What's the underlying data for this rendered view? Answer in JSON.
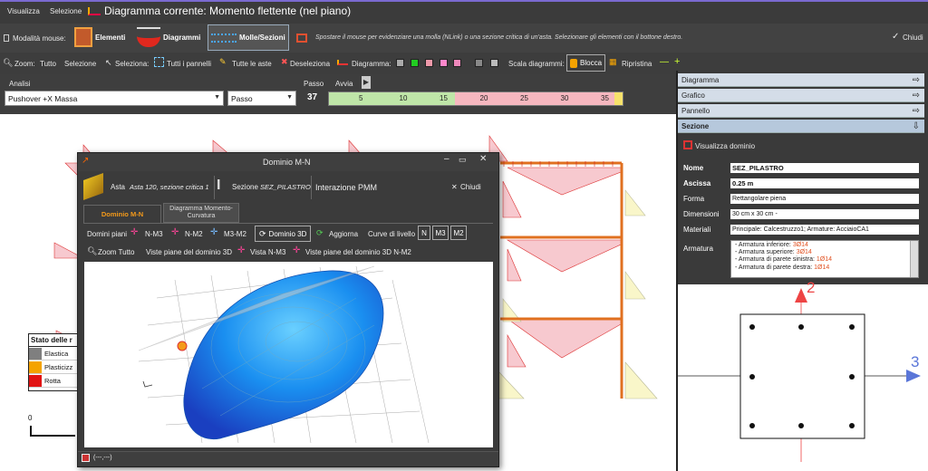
{
  "topbar": {
    "menu_visualizza": "Visualizza",
    "menu_selezione": "Selezione",
    "title": "Diagramma corrente: Momento flettente (nel piano)"
  },
  "modebar": {
    "label": "Modalità mouse:",
    "elementi": "Elementi",
    "diagrammi": "Diagrammi",
    "molle": "Molle/Sezioni",
    "hint": "Spostare il mouse per evidenziare una molla (NLink) o una sezione critica di un'asta. Selezionare gli elementi con il bottone destro.",
    "chiudi": "Chiudi"
  },
  "toolbar": {
    "zoom": "Zoom:",
    "tutto": "Tutto",
    "selezione": "Selezione",
    "seleziona": "Seleziona:",
    "tutti_pannelli": "Tutti i pannelli",
    "tutte_aste": "Tutte le aste",
    "deseleziona": "Deseleziona",
    "diagramma": "Diagramma:",
    "scala": "Scala diagrammi:",
    "blocca": "Blocca",
    "ripristina": "Ripristina"
  },
  "analysis": {
    "label": "Analisi",
    "value": "Pushover +X Massa",
    "passo_select": "Passo",
    "passo_label": "Passo",
    "avvia_label": "Avvia",
    "step": "37",
    "ticks": [
      "5",
      "10",
      "15",
      "20",
      "25",
      "30",
      "35"
    ]
  },
  "right_panel": {
    "tabs": [
      "Diagramma",
      "Grafico",
      "Pannello",
      "Sezione"
    ],
    "visualizza_dominio": "Visualizza dominio",
    "fields": [
      {
        "label": "Nome",
        "value": "SEZ_PILASTRO",
        "bold": true
      },
      {
        "label": "Ascissa",
        "value": "0.25 m",
        "bold": true
      },
      {
        "label": "Forma",
        "value": "Rettangolare piena",
        "bold": false
      },
      {
        "label": "Dimensioni",
        "value": "30 cm x 30 cm -",
        "bold": false
      },
      {
        "label": "Materiali",
        "value": "Principale: Calcestruzzo1; Armature: AcciaioCA1",
        "bold": false
      }
    ],
    "armatura_label": "Armatura",
    "armatura_lines": [
      {
        "text": "- Armatura inferiore: ",
        "value": "3Ø14"
      },
      {
        "text": "- Armatura superiore: ",
        "value": "3Ø14"
      },
      {
        "text": "- Armatura di parete sinistra: ",
        "value": "1Ø14"
      },
      {
        "text": "- Armatura di parete destra: ",
        "value": "1Ø14"
      }
    ],
    "axis_2": "2",
    "axis_3": "3"
  },
  "legend": {
    "title": "Stato delle r",
    "items": [
      {
        "label": "Elastica",
        "color": "#7f7f7f"
      },
      {
        "label": "Plasticizz",
        "color": "#f4a300"
      },
      {
        "label": "Rotta",
        "color": "#e11414"
      }
    ],
    "scale_zero": "0"
  },
  "dialog": {
    "title": "Dominio M-N",
    "asta_label": "Asta",
    "asta_value": "Asta 120, sezione critica 1",
    "sezione_label": "Sezione",
    "sezione_value": "SEZ_PILASTRO",
    "interazione": "Interazione PMM",
    "chiudi": "Chiudi",
    "tab1": "Dominio M-N",
    "tab2": "Diagramma Momento-Curvatura",
    "domini_piani": "Domini piani",
    "n_m3": "N-M3",
    "n_m2": "N-M2",
    "m3_m2": "M3-M2",
    "dominio_3d": "Dominio 3D",
    "aggiorna": "Aggiorna",
    "curve_livello": "Curve di livello",
    "lv_n": "N",
    "lv_m3": "M3",
    "lv_m2": "M2",
    "zoom_tutto": "Zoom Tutto",
    "viste_piane_3d": "Viste piane del dominio 3D",
    "vista_n_m3": "Vista N-M3",
    "viste_piane_n_m2": "Viste piane del dominio 3D N-M2",
    "status": "(---,---)"
  },
  "colors": {
    "accent": "#f49a1a",
    "bg_dark": "#3c3c3c",
    "panel_hdr": "#d4dde8",
    "domain_blue": "#1a8ff0",
    "frame_red": "#e0281e"
  }
}
